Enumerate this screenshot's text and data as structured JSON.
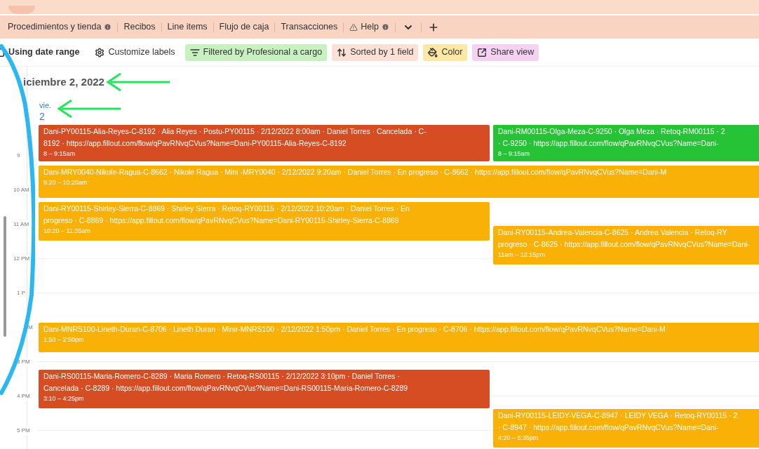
{
  "tabs": [
    {
      "label": "Procedimientos y tienda",
      "kind": "info"
    },
    {
      "label": "Recibos",
      "kind": "plain"
    },
    {
      "label": "Line items",
      "kind": "plain"
    },
    {
      "label": "Flujo de caja",
      "kind": "plain"
    },
    {
      "label": "Transacciones",
      "kind": "plain"
    },
    {
      "label": "Help",
      "kind": "help"
    }
  ],
  "toolbar": [
    {
      "kind": "check",
      "label": "Using date range"
    },
    {
      "kind": "gear",
      "label": "Customize labels"
    },
    {
      "kind": "filter",
      "label": "Filtered by Profesional a cargo",
      "color": "#c8f0c0"
    },
    {
      "kind": "sort",
      "label": "Sorted by 1 field",
      "color": "#fde0d6"
    },
    {
      "kind": "paint",
      "label": "Color",
      "color": "#fde8a6"
    },
    {
      "kind": "share",
      "label": "Share view",
      "color": "#f6d2f2"
    }
  ],
  "calendar": {
    "date_title": "iciembre 2, 2022",
    "weekday": "vie.",
    "day": "2",
    "hours": [
      "9",
      "10 AM",
      "11 AM",
      "12 PM",
      "1 P",
      "M",
      "3 PM",
      "4 PM",
      "5 PM"
    ],
    "events": [
      {
        "color": "#d64d24",
        "lines": [
          "Dani-PY00115-Alia-Reyes-C-8192 · Alia Reyes · Postu-PY00115 · 2/12/2022 8:00am · Daniel Torres · Cancelada · C-",
          "8192 · https://app.fillout.com/flow/qPavRNvqCVus?Name=Dani-PY00115-Alia-Reyes-C-8192"
        ],
        "time": "8 – 9:15am"
      },
      {
        "color": "#27c337",
        "lines": [
          "Dani-RM00115-Olga-Meza-C-9250 · Olga Meza · Retoq-RM00115 · 2",
          "· C-9250 · https://app.fillout.com/flow/qPavRNvqCVus?Name=Dani-"
        ],
        "time": "8 – 9:15am"
      },
      {
        "color": "#fab107",
        "lines": [
          "Dani-MRY0040-Nikole-Ragua-C-8662 · Nikole Ragua · Mini -MRY0040 · 2/12/2022 9:20am · Daniel Torres · En progreso · C-8662 · https://app.fillout.com/flow/qPavRNvqCVus?Name=Dani-M"
        ],
        "time": "9:20 – 10:20am"
      },
      {
        "color": "#fab107",
        "lines": [
          "Dani-RY00115-Shirley-Sierra-C-8869 · Shirley Sierra · Retoq-RY00115 · 2/12/2022 10:20am · Daniel Torres · En",
          "progreso · C-8869 · https://app.fillout.com/flow/qPavRNvqCVus?Name=Dani-RY00115-Shirley-Sierra-C-8869"
        ],
        "time": "10:20 – 11:35am"
      },
      {
        "color": "#fab107",
        "lines": [
          "Dani-RY00115-Andrea-Valencia-C-8625 · Andrea Valencia · Retoq-RY",
          "progreso · C-8625 · https://app.fillout.com/flow/qPavRNvqCVus?Name=Dani-"
        ],
        "time": "11am – 12:15pm"
      },
      {
        "color": "#fab107",
        "lines": [
          "Dani-MNRS100-Lineth-Duran-C-8706 · Lineth Duran · Minir-MNRS100 · 2/12/2022 1:50pm · Daniel Torres · En progreso · C-8706 · https://app.fillout.com/flow/qPavRNvqCVus?Name=Dani-M"
        ],
        "time": "1:50 – 2:50pm"
      },
      {
        "color": "#d64d24",
        "lines": [
          "Dani-RS00115-Maria-Romero-C-8289 · Maria Romero · Retoq-RS00115 · 2/12/2022 3:10pm · Daniel Torres ·",
          "Cancelada · C-8289 · https://app.fillout.com/flow/qPavRNvqCVus?Name=Dani-RS00115-Maria-Romero-C-8289"
        ],
        "time": "3:10 – 4:25pm"
      },
      {
        "color": "#fab107",
        "lines": [
          "Dani-RY00115-LEIDY-VEGA-C-8947 · LEIDY VEGA · Retoq-RY00115 · 2",
          "· C-8947 · https://app.fillout.com/flow/qPavRNvqCVus?Name=Dani-"
        ],
        "time": "4:20 – 5:35pm"
      }
    ]
  }
}
